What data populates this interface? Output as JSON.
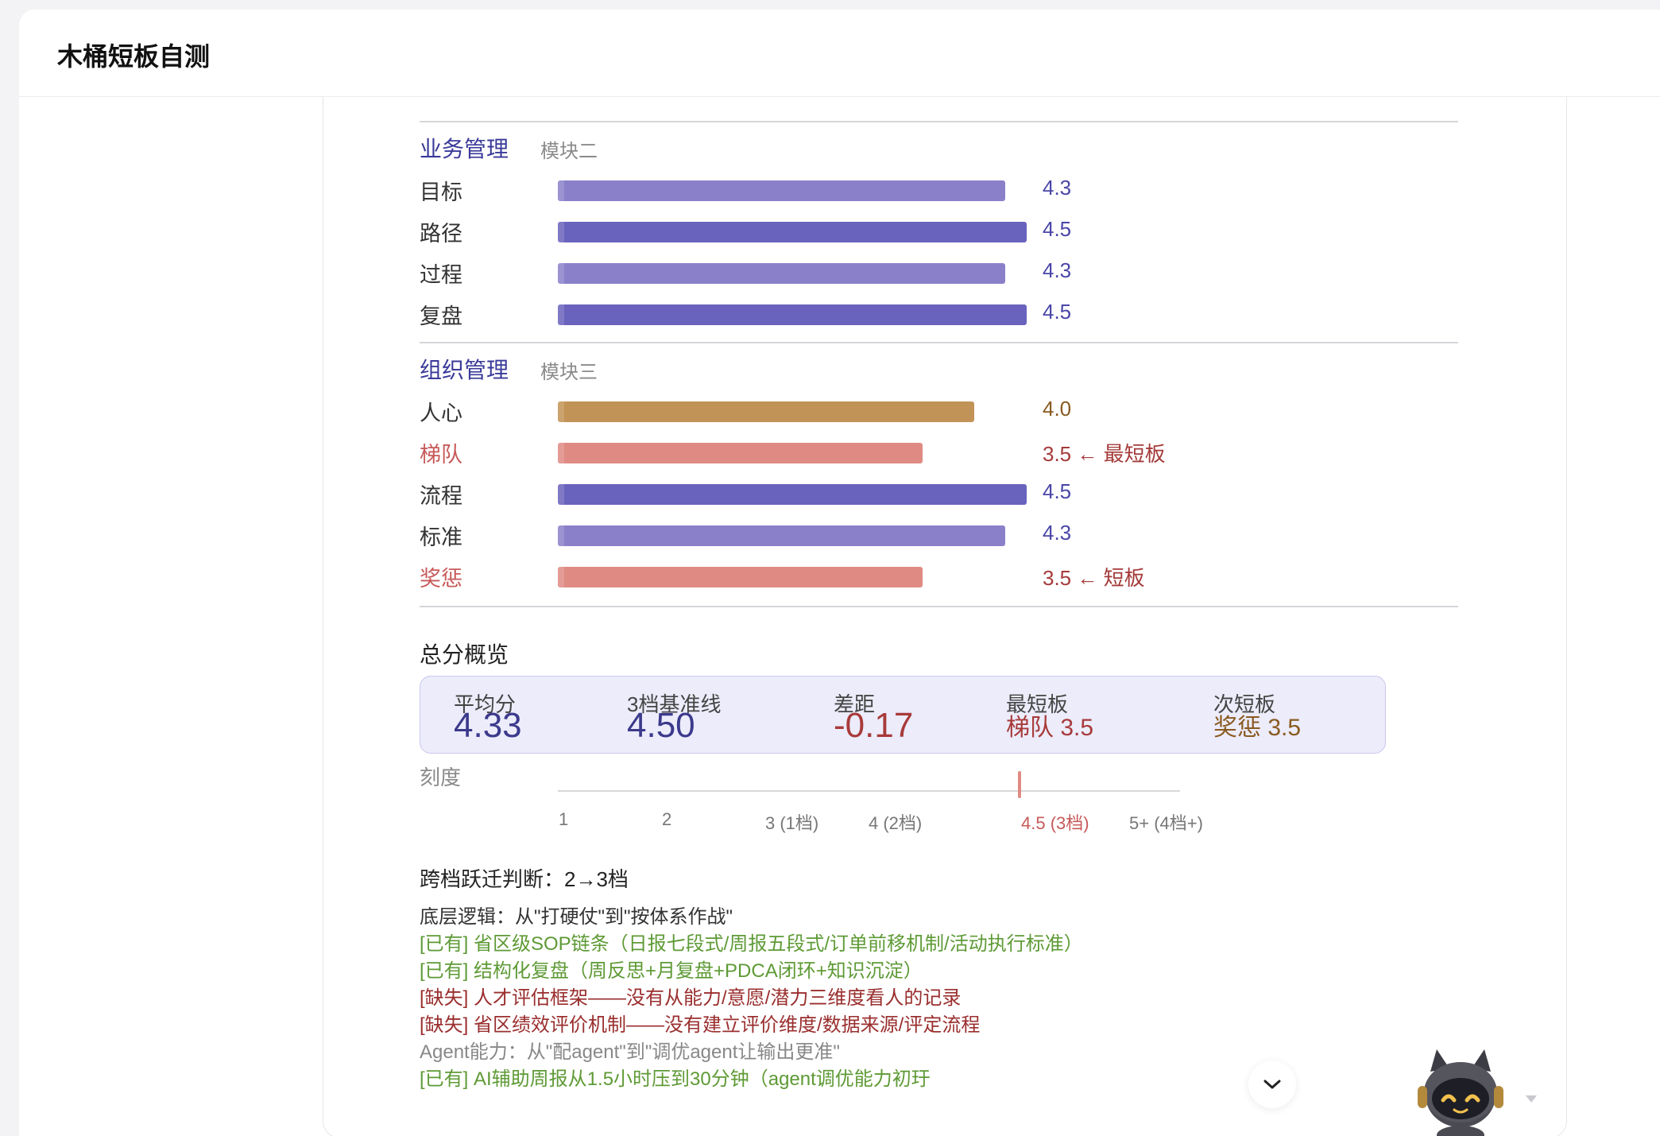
{
  "app": {
    "title": "木桶短板自测"
  },
  "module2": {
    "title": "业务管理",
    "subtitle": "模块二",
    "rows": [
      {
        "label": "目标",
        "score": "4.3",
        "value": 4.3
      },
      {
        "label": "路径",
        "score": "4.5",
        "value": 4.5
      },
      {
        "label": "过程",
        "score": "4.3",
        "value": 4.3
      },
      {
        "label": "复盘",
        "score": "4.5",
        "value": 4.5
      }
    ]
  },
  "module3": {
    "title": "组织管理",
    "subtitle": "模块三",
    "rows": [
      {
        "label": "人心",
        "score": "4.0",
        "value": 4.0
      },
      {
        "label": "梯队",
        "score": "3.5 ← 最短板",
        "value": 3.5
      },
      {
        "label": "流程",
        "score": "4.5",
        "value": 4.5
      },
      {
        "label": "标准",
        "score": "4.3",
        "value": 4.3
      },
      {
        "label": "奖惩",
        "score": "3.5 ← 短板",
        "value": 3.5
      }
    ]
  },
  "overview": {
    "title": "总分概览",
    "stats": [
      {
        "label": "平均分",
        "value": "4.33"
      },
      {
        "label": "3档基准线",
        "value": "4.50"
      },
      {
        "label": "差距",
        "value": "-0.17"
      },
      {
        "label": "最短板",
        "value": "梯队 3.5"
      },
      {
        "label": "次短板",
        "value": "奖惩 3.5"
      }
    ],
    "scale_label": "刻度",
    "ticks": [
      "1",
      "2",
      "3 (1档)",
      "4 (2档)",
      "4.5 (3档)",
      "5+ (4档+)"
    ],
    "marker_value": 4.5
  },
  "analysis": {
    "judgement": "跨档跃迁判断：2→3档",
    "logic": "底层逻辑：从\"打硬仗\"到\"按体系作战\"",
    "items": [
      "[已有] 省区级SOP链条（日报七段式/周报五段式/订单前移机制/活动执行标准）",
      "[已有] 结构化复盘（周反思+月复盘+PDCA闭环+知识沉淀）",
      "[缺失] 人才评估框架——没有从能力/意愿/潜力三维度看人的记录",
      "[缺失] 省区绩效评价机制——没有建立评价维度/数据来源/评定流程"
    ],
    "agent_line": "Agent能力：从\"配agent\"到\"调优agent让输出更准\"",
    "agent_item": "[已有] AI辅助周报从1.5小时压到30分钟（agent调优能力初玗"
  },
  "colors": {
    "bar_43": "#8a80ca",
    "bar_45": "#6a63bd",
    "bar_40": "#c29356",
    "bar_35": "#e08a84",
    "accent": "#3a3a9a"
  },
  "icons": {
    "scroll": "chevron-down-icon",
    "assistant": "robot-cat-mascot-icon"
  }
}
